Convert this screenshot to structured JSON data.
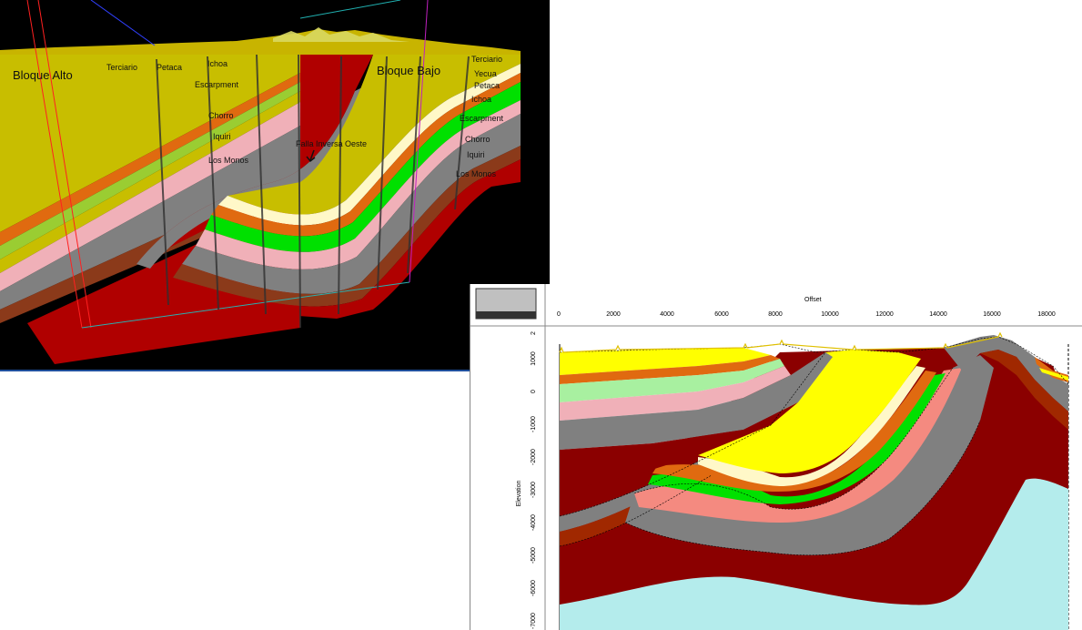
{
  "view3d": {
    "blocks": {
      "left": "Bloque Alto",
      "right": "Bloque Bajo"
    },
    "fault_label": "Falla Inversa Oeste",
    "left_units": [
      "Terciario",
      "Petaca",
      "Ichoa",
      "Escarpment",
      "Chorro",
      "Iquiri",
      "Los Monos"
    ],
    "right_units": [
      "Terciario",
      "Yecua",
      "Petaca",
      "Ichoa",
      "Escarpment",
      "Chorro",
      "Iquiri",
      "Los Monos"
    ]
  },
  "section": {
    "x_title": "Offset",
    "y_title": "Elevation",
    "x_ticks": [
      "0",
      "2000",
      "4000",
      "6000",
      "8000",
      "10000",
      "12000",
      "14000",
      "16000",
      "18000"
    ],
    "y_ticks": [
      "2",
      "1000",
      "0",
      "-1000",
      "-2000",
      "-3000",
      "-4000",
      "-5000",
      "-6000",
      "-7000"
    ]
  },
  "colors": {
    "terciario": "#c8be00",
    "yellow": "#ffff00",
    "orange": "#e06a10",
    "lime": "#9acd32",
    "green": "#00e000",
    "lightgreen": "#a8f0a0",
    "cream": "#fff8c8",
    "pink": "#f0b0b8",
    "salmon": "#f48a80",
    "gray": "#808080",
    "brown": "#8b3a1a",
    "rust": "#a02800",
    "darkred": "#8b0000",
    "red": "#b00000",
    "basement": "#b4ecec"
  }
}
